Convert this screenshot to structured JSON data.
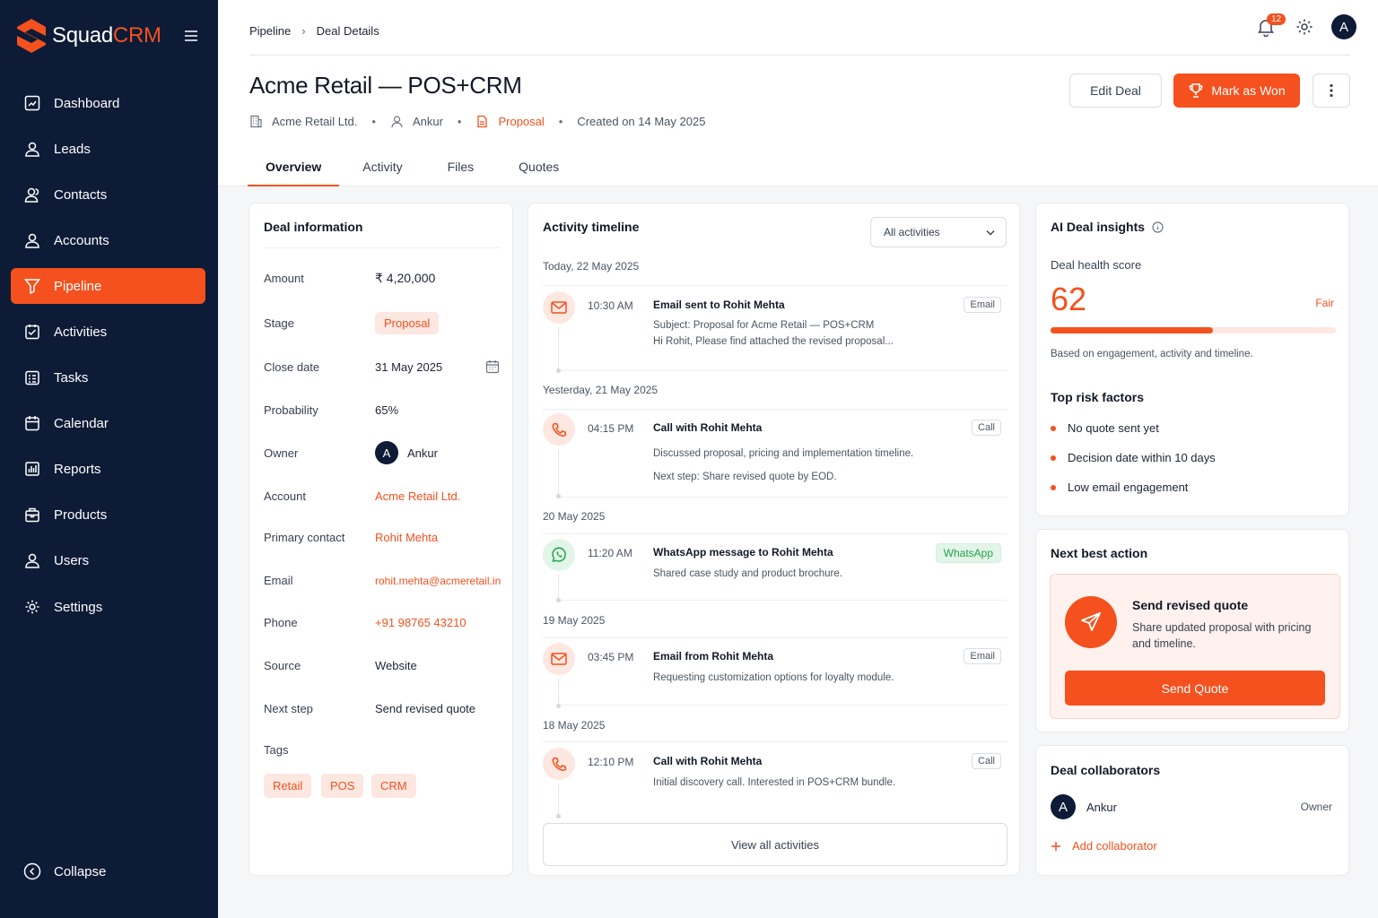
{
  "app": {
    "name_main": "Squad",
    "name_accent": "CRM"
  },
  "sidebar": {
    "items": [
      {
        "label": "Dashboard",
        "icon": "dashboard-icon"
      },
      {
        "label": "Leads",
        "icon": "user-icon"
      },
      {
        "label": "Contacts",
        "icon": "users-icon"
      },
      {
        "label": "Accounts",
        "icon": "user-icon"
      },
      {
        "label": "Pipeline",
        "icon": "filter-icon",
        "active": true
      },
      {
        "label": "Activities",
        "icon": "checklist-icon"
      },
      {
        "label": "Tasks",
        "icon": "tasks-icon"
      },
      {
        "label": "Calendar",
        "icon": "calendar-icon"
      },
      {
        "label": "Reports",
        "icon": "reports-icon"
      },
      {
        "label": "Products",
        "icon": "products-icon"
      },
      {
        "label": "Users",
        "icon": "users-icon"
      },
      {
        "label": "Settings",
        "icon": "gear-icon"
      }
    ],
    "collapse_label": "Collapse"
  },
  "header": {
    "breadcrumb": [
      "Pipeline",
      "Deal Details"
    ],
    "notifications_count": "12",
    "avatar_initial": "A"
  },
  "deal": {
    "title": "Acme Retail — POS+CRM",
    "company": "Acme Retail Ltd.",
    "owner": "Ankur",
    "stage": "Proposal",
    "created": "Created on 14 May 2025",
    "actions": {
      "edit": "Edit Deal",
      "won": "Mark as Won"
    }
  },
  "tabs": [
    "Overview",
    "Activity",
    "Files",
    "Quotes"
  ],
  "deal_info": {
    "title": "Deal information",
    "rows": {
      "amount": {
        "label": "Amount",
        "value": "₹ 4,20,000"
      },
      "stage": {
        "label": "Stage",
        "value": "Proposal"
      },
      "close_date": {
        "label": "Close date",
        "value": "31 May 2025"
      },
      "probability": {
        "label": "Probability",
        "value": "65%"
      },
      "owner": {
        "label": "Owner",
        "value": "Ankur",
        "initial": "A"
      },
      "account": {
        "label": "Account",
        "value": "Acme Retail Ltd."
      },
      "primary_contact": {
        "label": "Primary contact",
        "value": "Rohit Mehta"
      },
      "email": {
        "label": "Email",
        "value": "rohit.mehta@acmeretail.in"
      },
      "phone": {
        "label": "Phone",
        "value": "+91 98765 43210"
      },
      "source": {
        "label": "Source",
        "value": "Website"
      },
      "next_step": {
        "label": "Next step",
        "value": "Send revised quote"
      }
    },
    "tags_label": "Tags",
    "tags": [
      "Retail",
      "POS",
      "CRM"
    ]
  },
  "timeline": {
    "title": "Activity timeline",
    "filter": "All activities",
    "dates": [
      "Today, 22 May 2025",
      "Yesterday, 21 May 2025",
      "20 May 2025",
      "19 May 2025",
      "18 May 2025"
    ],
    "items": [
      {
        "type": "email",
        "time": "10:30 AM",
        "title": "Email sent to Rohit Mehta",
        "badge": "Email",
        "line1": "Subject: Proposal for Acme Retail — POS+CRM",
        "line2": "Hi Rohit, Please find attached the revised proposal..."
      },
      {
        "type": "call",
        "time": "04:15 PM",
        "title": "Call with Rohit Mehta",
        "badge": "Call",
        "line1": "Discussed proposal, pricing and implementation timeline.",
        "line2": "Next step: Share revised quote by EOD."
      },
      {
        "type": "whatsapp",
        "time": "11:20 AM",
        "title": "WhatsApp message to Rohit Mehta",
        "badge": "WhatsApp",
        "line1": "Shared case study and product brochure."
      },
      {
        "type": "email",
        "time": "03:45 PM",
        "title": "Email from Rohit Mehta",
        "badge": "Email",
        "line1": "Requesting customization options for loyalty module."
      },
      {
        "type": "call",
        "time": "12:10 PM",
        "title": "Call with Rohit Mehta",
        "badge": "Call",
        "line1": "Initial discovery call. Interested in POS+CRM bundle."
      }
    ],
    "view_all": "View all activities"
  },
  "ai": {
    "title": "AI Deal insights",
    "health_label": "Deal health score",
    "score": "62",
    "score_fraction": 0.57,
    "rating": "Fair",
    "basis": "Based on engagement, activity and timeline.",
    "risks_title": "Top risk factors",
    "risks": [
      "No quote sent yet",
      "Decision date within 10 days",
      "Low email engagement"
    ]
  },
  "next_action": {
    "title": "Next best action",
    "action_title": "Send revised quote",
    "action_desc": "Share updated proposal with pricing and timeline.",
    "button": "Send Quote"
  },
  "collaborators": {
    "title": "Deal collaborators",
    "people": [
      {
        "initial": "A",
        "name": "Ankur",
        "role": "Owner"
      }
    ],
    "add": "Add collaborator"
  },
  "colors": {
    "accent": "#f4511e",
    "sidebar": "#0d1b36",
    "whatsapp": "#22a34a"
  }
}
